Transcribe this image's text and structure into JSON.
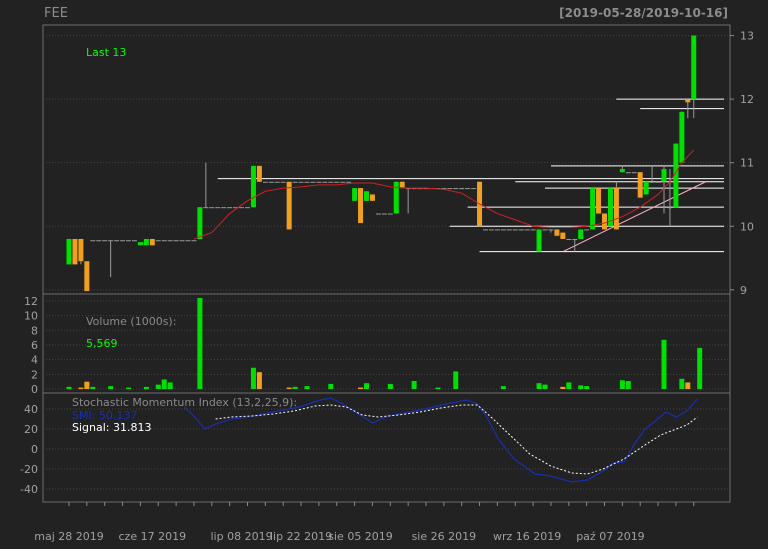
{
  "header": {
    "ticker": "FEE",
    "range": "[2019-05-28/2019-10-16]"
  },
  "colors": {
    "background": "#222222",
    "up": "#00e000",
    "down": "#f0a020",
    "grid": "#444444",
    "text": "#a0a0a0",
    "ma": "#d02020",
    "smi": "#1a2fb0",
    "signal": "#ffffff",
    "highlight": "#00ff00"
  },
  "labels": {
    "last": "Last 13",
    "volume_title": "Volume (1000s):",
    "volume_value": "5,569",
    "smi_title": "Stochastic Momentum Index (13,2,25,9):",
    "smi_value": "SMI: 50.137",
    "signal_value": "Signal: 31.813"
  },
  "chart_data": [
    {
      "type": "candlestick",
      "y_ticks": [
        9,
        10,
        11,
        12,
        13
      ],
      "ylim": [
        8.95,
        13.15
      ],
      "x_tick_labels": [
        "maj 28 2019",
        "cze 17 2019",
        "lip 08 2019",
        "lip 22 2019",
        "sie 05 2019",
        "sie 26 2019",
        "wrz 16 2019",
        "paź 07 2019"
      ],
      "x_tick_index": [
        0,
        14,
        29,
        39,
        49,
        63,
        77,
        91
      ],
      "candles": [
        [
          9.4,
          9.8,
          9.4,
          9.8
        ],
        [
          9.8,
          9.8,
          9.4,
          9.4
        ],
        [
          9.8,
          9.8,
          9.4,
          9.45
        ],
        [
          9.45,
          9.45,
          8.98,
          8.98
        ],
        [
          9.78,
          9.78,
          9.78,
          9.78
        ],
        [
          9.78,
          9.78,
          9.78,
          9.78
        ],
        [
          9.78,
          9.78,
          9.78,
          9.78
        ],
        [
          9.78,
          9.78,
          9.2,
          9.78
        ],
        [
          9.78,
          9.78,
          9.78,
          9.78
        ],
        [
          9.78,
          9.78,
          9.78,
          9.78
        ],
        [
          9.78,
          9.78,
          9.78,
          9.78
        ],
        [
          9.78,
          9.78,
          9.78,
          9.78
        ],
        [
          9.7,
          9.75,
          9.7,
          9.75
        ],
        [
          9.7,
          9.8,
          9.7,
          9.8
        ],
        [
          9.8,
          9.8,
          9.7,
          9.7
        ],
        [
          9.78,
          9.78,
          9.78,
          9.78
        ],
        [
          9.78,
          9.78,
          9.78,
          9.78
        ],
        [
          9.78,
          9.78,
          9.78,
          9.78
        ],
        [
          9.78,
          9.78,
          9.78,
          9.78
        ],
        [
          9.78,
          9.78,
          9.78,
          9.78
        ],
        [
          9.78,
          9.78,
          9.78,
          9.78
        ],
        [
          9.78,
          9.78,
          9.78,
          9.78
        ],
        [
          9.8,
          10.3,
          9.8,
          10.3
        ],
        [
          10.3,
          11.0,
          10.3,
          10.3
        ],
        [
          10.3,
          10.3,
          10.3,
          10.3
        ],
        [
          10.3,
          10.3,
          10.3,
          10.3
        ],
        [
          10.3,
          10.3,
          10.3,
          10.3
        ],
        [
          10.3,
          10.3,
          10.3,
          10.3
        ],
        [
          10.3,
          10.3,
          10.3,
          10.3
        ],
        [
          10.3,
          10.3,
          10.3,
          10.3
        ],
        [
          10.3,
          10.3,
          10.3,
          10.3
        ],
        [
          10.3,
          10.95,
          10.3,
          10.95
        ],
        [
          10.95,
          10.95,
          10.7,
          10.7
        ],
        [
          10.7,
          10.7,
          10.7,
          10.7
        ],
        [
          10.7,
          10.7,
          10.7,
          10.7
        ],
        [
          10.7,
          10.7,
          10.7,
          10.7
        ],
        [
          10.7,
          10.7,
          10.7,
          10.7
        ],
        [
          10.7,
          10.7,
          9.95,
          9.95
        ],
        [
          10.7,
          10.7,
          10.7,
          10.7
        ],
        [
          10.7,
          10.7,
          10.7,
          10.7
        ],
        [
          10.7,
          10.7,
          10.7,
          10.7
        ],
        [
          10.7,
          10.7,
          10.7,
          10.7
        ],
        [
          10.7,
          10.7,
          10.7,
          10.7
        ],
        [
          10.7,
          10.7,
          10.7,
          10.7
        ],
        [
          10.7,
          10.7,
          10.7,
          10.7
        ],
        [
          10.7,
          10.7,
          10.7,
          10.7
        ],
        [
          10.7,
          10.7,
          10.7,
          10.7
        ],
        [
          10.7,
          10.7,
          10.7,
          10.7
        ],
        [
          10.4,
          10.6,
          10.4,
          10.6
        ],
        [
          10.6,
          10.6,
          10.05,
          10.05
        ],
        [
          10.4,
          10.55,
          10.4,
          10.55
        ],
        [
          10.5,
          10.5,
          10.4,
          10.4
        ],
        [
          10.2,
          10.2,
          10.2,
          10.2
        ],
        [
          10.2,
          10.2,
          10.2,
          10.2
        ],
        [
          10.2,
          10.2,
          10.2,
          10.2
        ],
        [
          10.2,
          10.7,
          10.2,
          10.7
        ],
        [
          10.7,
          10.7,
          10.6,
          10.6
        ],
        [
          10.6,
          10.6,
          10.2,
          10.6
        ],
        [
          10.6,
          10.6,
          10.6,
          10.6
        ],
        [
          10.6,
          10.6,
          10.6,
          10.6
        ],
        [
          10.6,
          10.6,
          10.6,
          10.6
        ],
        [
          10.6,
          10.6,
          10.6,
          10.6
        ],
        [
          10.6,
          10.6,
          10.6,
          10.6
        ],
        [
          10.6,
          10.6,
          10.6,
          10.6
        ],
        [
          10.6,
          10.6,
          10.6,
          10.6
        ],
        [
          10.6,
          10.6,
          10.6,
          10.6
        ],
        [
          10.6,
          10.6,
          10.6,
          10.6
        ],
        [
          10.6,
          10.6,
          10.6,
          10.6
        ],
        [
          10.6,
          10.6,
          10.6,
          10.6
        ],
        [
          10.7,
          10.7,
          10.0,
          10.0
        ],
        [
          9.95,
          9.95,
          9.95,
          9.95
        ],
        [
          9.95,
          9.95,
          9.95,
          9.95
        ],
        [
          9.95,
          9.95,
          9.95,
          9.95
        ],
        [
          9.95,
          9.95,
          9.95,
          9.95
        ],
        [
          9.95,
          9.95,
          9.95,
          9.95
        ],
        [
          9.95,
          9.95,
          9.95,
          9.95
        ],
        [
          9.95,
          9.95,
          9.95,
          9.95
        ],
        [
          9.95,
          9.95,
          9.95,
          9.95
        ],
        [
          9.95,
          9.95,
          9.95,
          9.95
        ],
        [
          9.6,
          9.95,
          9.6,
          9.95
        ],
        [
          9.95,
          9.95,
          9.95,
          9.95
        ],
        [
          9.95,
          9.95,
          9.9,
          9.95
        ],
        [
          9.95,
          9.95,
          9.85,
          9.85
        ],
        [
          9.9,
          9.9,
          9.8,
          9.8
        ],
        [
          9.8,
          9.8,
          9.8,
          9.8
        ],
        [
          9.8,
          9.8,
          9.6,
          9.8
        ],
        [
          9.8,
          9.95,
          9.8,
          9.95
        ],
        [
          9.95,
          9.95,
          9.95,
          9.95
        ],
        [
          9.95,
          10.6,
          9.95,
          10.6
        ],
        [
          10.6,
          10.6,
          10.2,
          10.2
        ],
        [
          10.2,
          10.2,
          9.95,
          9.95
        ],
        [
          10.0,
          10.6,
          10.0,
          10.6
        ],
        [
          10.6,
          10.7,
          9.95,
          9.95
        ],
        [
          10.85,
          10.95,
          10.85,
          10.9
        ],
        [
          10.85,
          10.85,
          10.85,
          10.85
        ],
        [
          10.85,
          10.85,
          10.85,
          10.85
        ],
        [
          10.85,
          10.85,
          10.45,
          10.45
        ],
        [
          10.5,
          10.7,
          10.5,
          10.7
        ],
        [
          10.7,
          10.95,
          10.7,
          10.7
        ],
        [
          10.7,
          10.7,
          10.7,
          10.7
        ],
        [
          10.7,
          10.95,
          10.2,
          10.9
        ],
        [
          10.3,
          10.9,
          10.0,
          10.3
        ],
        [
          10.3,
          11.3,
          10.3,
          11.3
        ],
        [
          11.0,
          11.8,
          11.0,
          11.8
        ],
        [
          12.0,
          12.0,
          11.7,
          11.95
        ],
        [
          12.0,
          13.0,
          11.7,
          13.0
        ]
      ],
      "moving_average": [
        [
          21,
          9.8
        ],
        [
          24,
          9.9
        ],
        [
          27,
          10.2
        ],
        [
          30,
          10.4
        ],
        [
          33,
          10.55
        ],
        [
          36,
          10.6
        ],
        [
          39,
          10.62
        ],
        [
          42,
          10.65
        ],
        [
          45,
          10.65
        ],
        [
          48,
          10.68
        ],
        [
          51,
          10.68
        ],
        [
          54,
          10.62
        ],
        [
          57,
          10.6
        ],
        [
          60,
          10.6
        ],
        [
          63,
          10.58
        ],
        [
          66,
          10.52
        ],
        [
          69,
          10.35
        ],
        [
          72,
          10.2
        ],
        [
          75,
          10.1
        ],
        [
          78,
          10.0
        ],
        [
          81,
          9.98
        ],
        [
          84,
          9.98
        ],
        [
          87,
          10.0
        ],
        [
          90,
          10.05
        ],
        [
          93,
          10.15
        ],
        [
          96,
          10.3
        ],
        [
          99,
          10.5
        ],
        [
          101,
          10.7
        ],
        [
          103,
          11.0
        ],
        [
          105,
          11.2
        ]
      ],
      "support_resistance": [
        {
          "start": 64,
          "level": 10.0
        },
        {
          "start": 69,
          "level": 9.6
        },
        {
          "start": 67,
          "level": 10.3
        },
        {
          "start": 25,
          "level": 10.75
        },
        {
          "start": 75,
          "level": 10.7
        },
        {
          "start": 80,
          "level": 10.6
        },
        {
          "start": 81,
          "level": 10.95
        },
        {
          "start": 92,
          "level": 12.0
        },
        {
          "start": 96,
          "level": 11.85
        }
      ],
      "trend_line": [
        [
          83,
          9.6
        ],
        [
          107,
          10.7
        ]
      ]
    },
    {
      "type": "bar",
      "y_ticks": [
        0,
        2,
        4,
        6,
        8,
        10,
        12
      ],
      "ylim": [
        -0.4,
        12.8
      ],
      "values": {
        "0": 0.3,
        "2": 0.2,
        "3": 1.0,
        "4": 0.3,
        "7": 0.4,
        "10": 0.2,
        "13": 0.3,
        "15": 0.6,
        "16": 1.3,
        "17": 0.9,
        "22": 12.4,
        "31": 2.9,
        "32": 2.3,
        "37": 0.2,
        "38": 0.3,
        "40": 0.4,
        "44": 0.7,
        "49": 0.2,
        "50": 0.8,
        "54": 0.7,
        "58": 1.1,
        "62": 0.2,
        "65": 2.4,
        "73": 0.4,
        "79": 0.8,
        "80": 0.6,
        "83": 0.3,
        "84": 0.9,
        "86": 0.5,
        "87": 0.4,
        "93": 1.2,
        "94": 1.1,
        "100": 6.7,
        "103": 1.4,
        "104": 0.9,
        "106": 5.6
      }
    },
    {
      "type": "line",
      "y_ticks": [
        -40,
        -20,
        0,
        20,
        40
      ],
      "ylim": [
        -52,
        55
      ],
      "series": [
        {
          "name": "SMI",
          "points": [
            [
              22,
              42
            ],
            [
              24,
              32
            ],
            [
              26,
              20
            ],
            [
              28,
              25
            ],
            [
              31,
              30
            ],
            [
              33,
              31
            ],
            [
              36,
              34
            ],
            [
              40,
              38
            ],
            [
              44,
              42
            ],
            [
              48,
              49
            ],
            [
              50,
              51
            ],
            [
              52,
              46
            ],
            [
              55,
              36
            ],
            [
              58,
              26
            ],
            [
              61,
              33
            ],
            [
              64,
              36
            ],
            [
              68,
              40
            ],
            [
              72,
              45
            ],
            [
              76,
              49
            ],
            [
              78,
              45
            ],
            [
              80,
              30
            ],
            [
              82,
              10
            ],
            [
              85,
              -10
            ],
            [
              89,
              -25
            ],
            [
              92,
              -27
            ],
            [
              96,
              -33
            ],
            [
              99,
              -31
            ],
            [
              102,
              -22
            ],
            [
              104,
              -14
            ],
            [
              106,
              -13
            ],
            [
              108,
              5
            ],
            [
              110,
              20
            ],
            [
              112,
              28
            ],
            [
              114,
              37
            ],
            [
              116,
              32
            ],
            [
              118,
              38
            ],
            [
              120,
              50
            ]
          ]
        },
        {
          "name": "Signal",
          "points": [
            [
              28,
              30
            ],
            [
              31,
              32
            ],
            [
              35,
              33
            ],
            [
              39,
              35
            ],
            [
              43,
              38
            ],
            [
              47,
              43
            ],
            [
              50,
              44
            ],
            [
              53,
              42
            ],
            [
              56,
              34
            ],
            [
              59,
              32
            ],
            [
              63,
              34
            ],
            [
              67,
              37
            ],
            [
              71,
              41
            ],
            [
              75,
              44
            ],
            [
              78,
              44
            ],
            [
              81,
              30
            ],
            [
              84,
              15
            ],
            [
              88,
              -5
            ],
            [
              92,
              -17
            ],
            [
              96,
              -24
            ],
            [
              99,
              -25
            ],
            [
              102,
              -20
            ],
            [
              106,
              -10
            ],
            [
              110,
              4
            ],
            [
              113,
              14
            ],
            [
              116,
              20
            ],
            [
              118,
              24
            ],
            [
              120,
              32
            ]
          ]
        }
      ]
    }
  ]
}
